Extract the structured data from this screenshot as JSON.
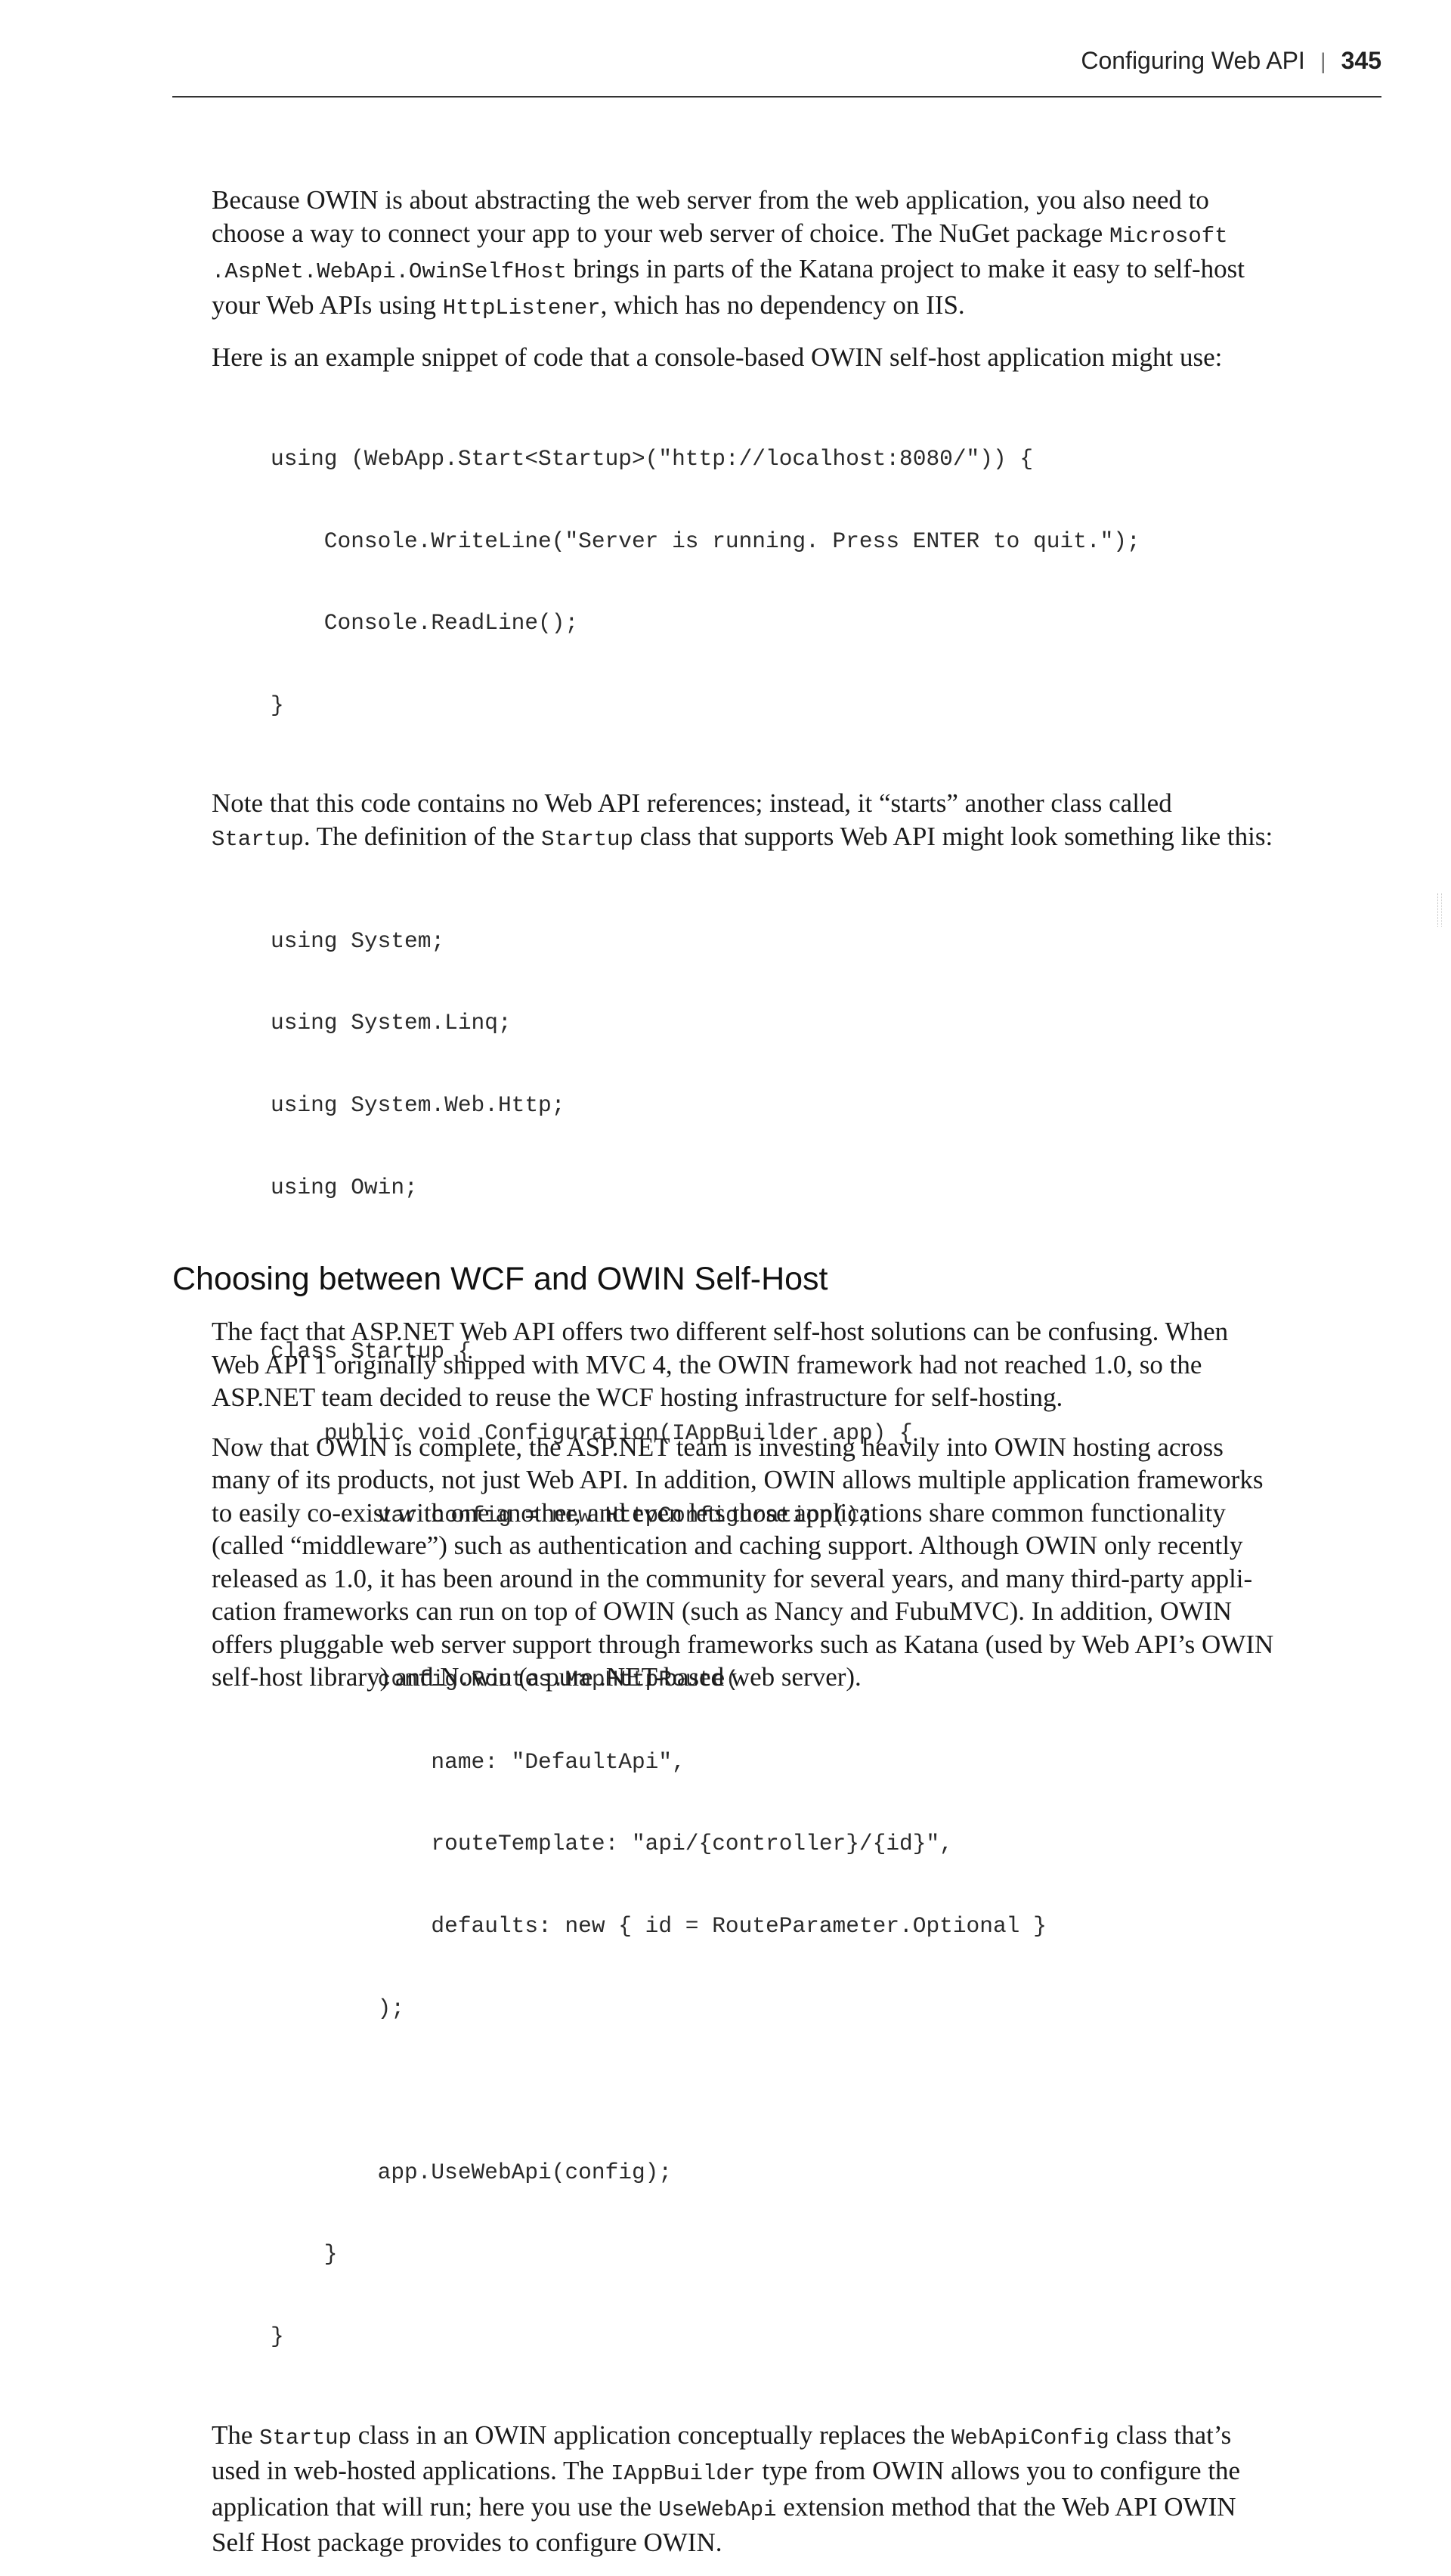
{
  "header": {
    "running_title": "Configuring Web API",
    "separator": "|",
    "page_number": "345"
  },
  "para1": {
    "l1": "Because OWIN is about abstracting the web server from the web application, you also need to",
    "l2_text": "choose a way to connect your app to your web server of choice. The NuGet package ",
    "l2_code": "Microsoft",
    "l3_code": ".AspNet.WebApi.OwinSelfHost",
    "l3_text": " brings in parts of the Katana project to make it easy to self-host",
    "l4_text_a": "your Web APIs using ",
    "l4_code": "HttpListener",
    "l4_text_b": ", which has no dependency on IIS."
  },
  "para2": "Here is an example snippet of code that a console-based OWIN self-host application might use:",
  "code1": [
    "using (WebApp.Start<Startup>(\"http://localhost:8080/\")) {",
    "    Console.WriteLine(\"Server is running. Press ENTER to quit.\");",
    "    Console.ReadLine();",
    "}"
  ],
  "para3": {
    "l1": "Note that this code contains no Web API references; instead, it “starts” another class called",
    "l2_code_a": "Startup",
    "l2_text_a": ". The definition of the ",
    "l2_code_b": "Startup",
    "l2_text_b": " class that supports Web API might look something like this:"
  },
  "code2": [
    "using System;",
    "using System.Linq;",
    "using System.Web.Http;",
    "using Owin;",
    "",
    "class Startup {",
    "    public void Configuration(IAppBuilder app) {",
    "        var config = new HttpConfiguration();",
    "",
    "        config.Routes.MapHttpRoute(",
    "            name: \"DefaultApi\",",
    "            routeTemplate: \"api/{controller}/{id}\",",
    "            defaults: new { id = RouteParameter.Optional }",
    "        );",
    "",
    "        app.UseWebApi(config);",
    "    }",
    "}"
  ],
  "para4": {
    "l1_text_a": "The ",
    "l1_code_a": "Startup",
    "l1_text_b": " class in an OWIN application conceptually replaces the ",
    "l1_code_b": "WebApiConfig",
    "l1_text_c": " class that’s",
    "l2_text_a": "used in web-hosted applications. The ",
    "l2_code": "IAppBuilder",
    "l2_text_b": " type from OWIN allows you to configure the",
    "l3_text_a": "application that will run; here you use the ",
    "l3_code": "UseWebApi",
    "l3_text_b": " extension method that the Web API OWIN",
    "l4": "Self Host package provides to configure OWIN."
  },
  "section_title": "Choosing between WCF and OWIN Self-Host",
  "para5": [
    "The fact that ASP.NET Web API offers two different self-host solutions can be confusing. When",
    "Web API 1 originally shipped with MVC 4, the OWIN framework had not reached 1.0, so the",
    "ASP.NET team decided to reuse the WCF hosting infrastructure for self-hosting."
  ],
  "para6": [
    "Now that OWIN is complete, the ASP.NET team is investing heavily into OWIN hosting across",
    "many of its products, not just Web API. In addition, OWIN allows multiple application frameworks",
    "to easily co-exist with one another, and even lets those applications share common functionality",
    "(called “middleware”) such as authentication and caching support. Although OWIN only recently",
    "released as 1.0, it has been around in the community for several years, and many third-party appli-",
    "cation frameworks can run on top of OWIN (such as Nancy and FubuMVC). In addition, OWIN",
    "offers pluggable web server support through frameworks such as Katana (used by Web API’s OWIN",
    "self-host library) and Nowin (a pure .NET-based web server)."
  ]
}
